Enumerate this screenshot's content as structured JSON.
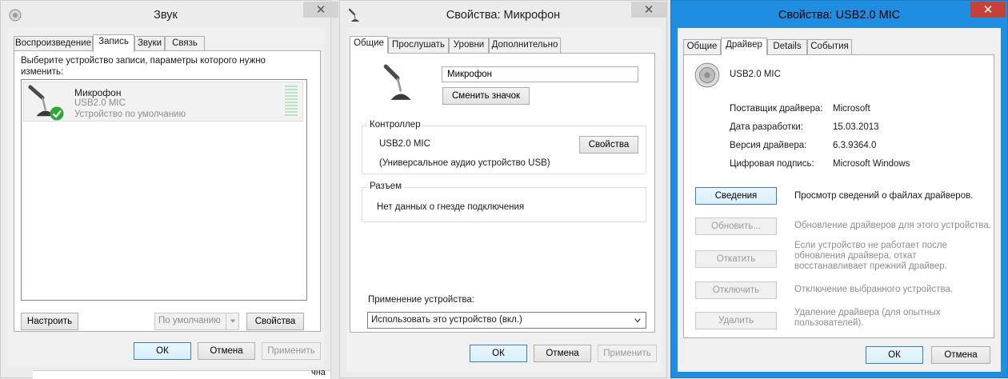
{
  "sound_window": {
    "title": "Звук",
    "close_label": "✕",
    "tabs": [
      "Воспроизведение",
      "Запись",
      "Звуки",
      "Связь"
    ],
    "active_tab": 1,
    "instruction": "Выберите устройство записи, параметры которого нужно изменить:",
    "device": {
      "name": "Микрофон",
      "model": "USB2.0 MIC",
      "status": "Устройство по умолчанию",
      "icon": "microphone-icon",
      "status_icon": "checkmark-icon"
    },
    "configure_label": "Настроить",
    "default_label": "По умолчанию",
    "properties_label": "Свойства",
    "ok_label": "ОК",
    "cancel_label": "Отмена",
    "apply_label": "Применить",
    "bottom_fragment": "чна"
  },
  "mic_window": {
    "title": "Свойства: Микрофон",
    "close_label": "✕",
    "tabs": [
      "Общие",
      "Прослушать",
      "Уровни",
      "Дополнительно"
    ],
    "active_tab": 0,
    "name_value": "Микрофон",
    "change_icon_label": "Сменить значок",
    "controller": {
      "label": "Контроллер",
      "name": "USB2.0 MIC",
      "properties_label": "Свойства",
      "description": "(Универсальное аудио устройство USB)"
    },
    "jack": {
      "label": "Разъем",
      "text": "Нет данных о гнезде подключения"
    },
    "usage_label": "Применение устройства:",
    "usage_value": "Использовать это устройство (вкл.)",
    "ok_label": "ОК",
    "cancel_label": "Отмена",
    "apply_label": "Применить"
  },
  "usb_window": {
    "title": "Свойства: USB2.0 MIC",
    "close_label": "✕",
    "tabs": [
      "Общие",
      "Драйвер",
      "Details",
      "События"
    ],
    "active_tab": 1,
    "device_name": "USB2.0 MIC",
    "info": [
      {
        "label": "Поставщик драйвера:",
        "value": "Microsoft"
      },
      {
        "label": "Дата разработки:",
        "value": "15.03.2013"
      },
      {
        "label": "Версия драйвера:",
        "value": "6.3.9364.0"
      },
      {
        "label": "Цифровая подпись:",
        "value": "Microsoft Windows"
      }
    ],
    "actions": [
      {
        "label": "Сведения",
        "desc": "Просмотр сведений о файлах драйверов.",
        "enabled": true
      },
      {
        "label": "Обновить...",
        "desc": "Обновление драйверов для этого устройства.",
        "enabled": false
      },
      {
        "label": "Откатить",
        "desc": "Если устройство не работает после обновления драйвера, откат восстанавливает прежний драйвер.",
        "enabled": false
      },
      {
        "label": "Отключить",
        "desc": "Отключение выбранного устройства.",
        "enabled": false
      },
      {
        "label": "Удалить",
        "desc": "Удаление драйвера (для опытных пользователей).",
        "enabled": false
      }
    ],
    "ok_label": "ОК",
    "cancel_label": "Отмена"
  },
  "colors": {
    "inactive_frame": "#ececec",
    "active_frame": "#1f8ee1",
    "active_close": "#c7413a",
    "selection": "#cce8ff",
    "checkmark": "#2fa637"
  }
}
